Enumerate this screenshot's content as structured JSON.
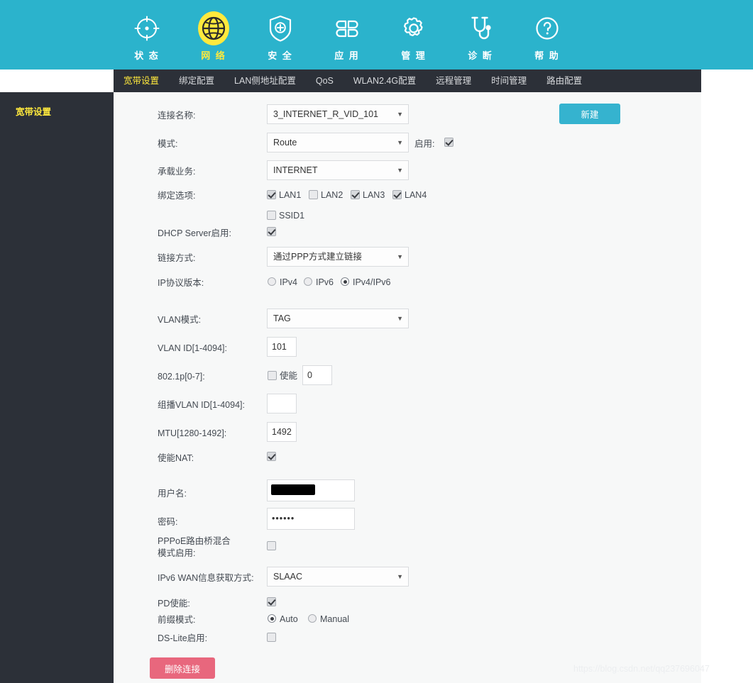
{
  "topnav": {
    "items": [
      {
        "label": "状 态",
        "icon": "target-icon",
        "active": false
      },
      {
        "label": "网 络",
        "icon": "globe-icon",
        "active": true
      },
      {
        "label": "安 全",
        "icon": "shield-plus-icon",
        "active": false
      },
      {
        "label": "应 用",
        "icon": "apps-grid-icon",
        "active": false
      },
      {
        "label": "管 理",
        "icon": "gear-icon",
        "active": false
      },
      {
        "label": "诊 断",
        "icon": "stethoscope-icon",
        "active": false
      },
      {
        "label": "帮 助",
        "icon": "question-circle-icon",
        "active": false
      }
    ]
  },
  "subnav": {
    "items": [
      {
        "label": "宽带设置",
        "active": true
      },
      {
        "label": "绑定配置",
        "active": false
      },
      {
        "label": "LAN侧地址配置",
        "active": false
      },
      {
        "label": "QoS",
        "active": false
      },
      {
        "label": "WLAN2.4G配置",
        "active": false
      },
      {
        "label": "远程管理",
        "active": false
      },
      {
        "label": "时间管理",
        "active": false
      },
      {
        "label": "路由配置",
        "active": false
      }
    ]
  },
  "sidebar": {
    "title": "宽带设置"
  },
  "form": {
    "connection_name": {
      "label": "连接名称:",
      "value": "3_INTERNET_R_VID_101"
    },
    "mode": {
      "label": "模式:",
      "value": "Route"
    },
    "enable": {
      "label": "启用:",
      "checked": true
    },
    "service": {
      "label": "承载业务:",
      "value": "INTERNET"
    },
    "binding": {
      "label": "绑定选项:",
      "options": [
        {
          "label": "LAN1",
          "checked": true
        },
        {
          "label": "LAN2",
          "checked": false
        },
        {
          "label": "LAN3",
          "checked": true
        },
        {
          "label": "LAN4",
          "checked": true
        },
        {
          "label": "SSID1",
          "checked": false
        }
      ]
    },
    "dhcp_server": {
      "label": "DHCP Server启用:",
      "checked": true
    },
    "link_mode": {
      "label": "链接方式:",
      "value": "通过PPP方式建立链接"
    },
    "ip_version": {
      "label": "IP协议版本:",
      "options": [
        {
          "label": "IPv4",
          "selected": false
        },
        {
          "label": "IPv6",
          "selected": false
        },
        {
          "label": "IPv4/IPv6",
          "selected": true
        }
      ]
    },
    "vlan_mode": {
      "label": "VLAN模式:",
      "value": "TAG"
    },
    "vlan_id": {
      "label": "VLAN ID[1-4094]:",
      "value": "101"
    },
    "dot1p": {
      "label": "802.1p[0-7]:",
      "enable_label": "使能",
      "checked": false,
      "value": "0"
    },
    "multicast_vlan_id": {
      "label": "组播VLAN ID[1-4094]:",
      "value": ""
    },
    "mtu": {
      "label": "MTU[1280-1492]:",
      "value": "1492"
    },
    "nat": {
      "label": "使能NAT:",
      "checked": true
    },
    "username": {
      "label": "用户名:",
      "value": "",
      "redacted": true
    },
    "password": {
      "label": "密码:",
      "value": "••••••"
    },
    "pppoe_mixed": {
      "label": "PPPoE路由桥混合模式启用:",
      "checked": false
    },
    "ipv6_wan": {
      "label": "IPv6 WAN信息获取方式:",
      "value": "SLAAC"
    },
    "pd_enable": {
      "label": "PD使能:",
      "checked": true
    },
    "prefix_mode": {
      "label": "前缀模式:",
      "options": [
        {
          "label": "Auto",
          "selected": true
        },
        {
          "label": "Manual",
          "selected": false
        }
      ]
    },
    "dslite": {
      "label": "DS-Lite启用:",
      "checked": false
    }
  },
  "buttons": {
    "new": "新建",
    "delete": "删除连接"
  },
  "watermark": "https://blog.csdn.net/qq237696047",
  "colors": {
    "header_teal": "#2bb3cc",
    "nav_dark": "#2c3038",
    "active_yellow": "#ffe93d",
    "new_button": "#35b3cf",
    "delete_button": "#e8677d",
    "content_bg": "#f7f8f8"
  }
}
